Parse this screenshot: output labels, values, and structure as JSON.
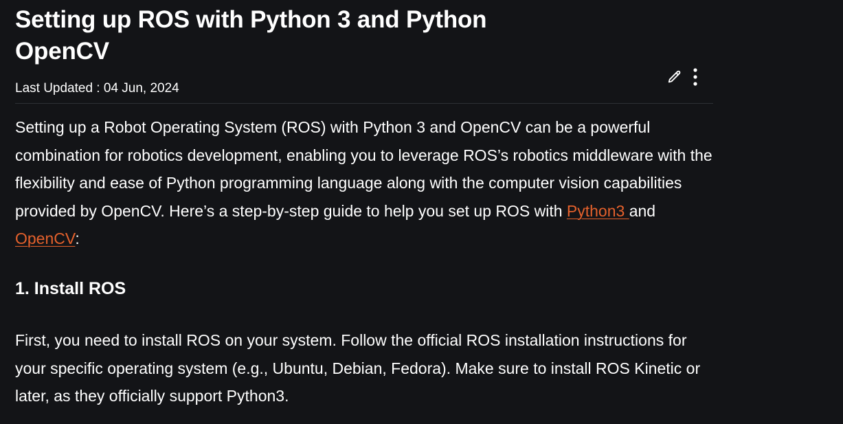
{
  "article": {
    "title": "Setting up ROS with Python 3 and Python OpenCV",
    "last_updated_label": "Last Updated : ",
    "last_updated_date": "04 Jun, 2024",
    "intro": {
      "text_before": "Setting up a Robot Operating System (ROS) with Python 3 and OpenCV can be a powerful combination for robotics development, enabling you to leverage ROS’s robotics middleware with the flexibility and ease of Python programming language along with the computer vision capabilities provided by OpenCV. Here’s a step-by-step guide to help you set up ROS with ",
      "link1": "Python3 ",
      "text_middle": "and ",
      "link2": "OpenCV",
      "text_after": ":"
    },
    "section1_heading": "1. Install ROS",
    "section1_text": "First, you need to install ROS on your system. Follow the official ROS installation instructions for your specific operating system (e.g., Ubuntu, Debian, Fedora). Make sure to install ROS Kinetic or later, as they officially support Python3."
  },
  "icons": {
    "edit": "pencil-icon",
    "more": "more-vertical-icon"
  },
  "colors": {
    "background": "#131417",
    "text": "#ffffff",
    "link": "#e5612c",
    "divider": "#2e3035"
  }
}
